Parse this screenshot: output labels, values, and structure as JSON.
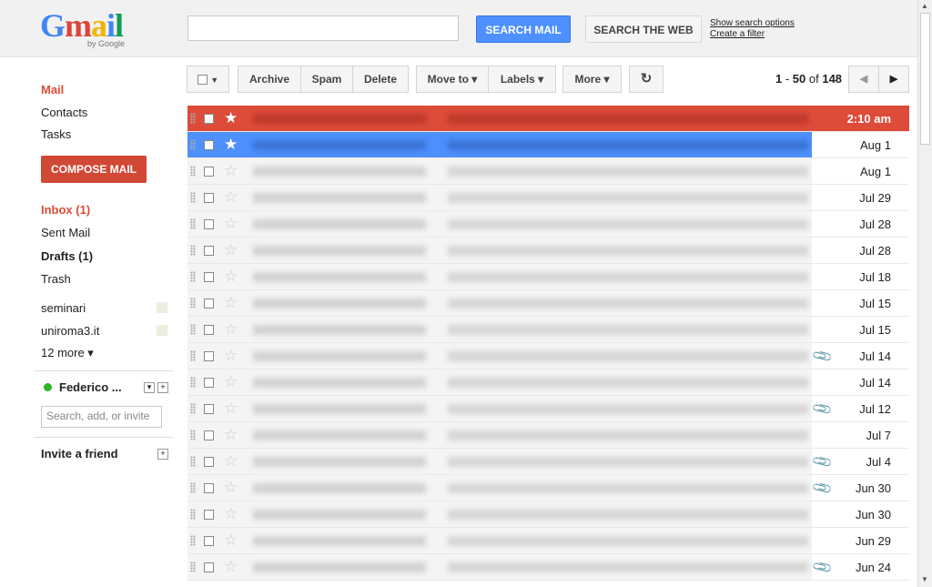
{
  "header": {
    "logo_text": "Gmail",
    "logo_byline": "by Google",
    "search_placeholder": "",
    "search_mail_label": "SEARCH MAIL",
    "search_web_label": "SEARCH THE WEB",
    "show_search_options": "Show search options",
    "create_filter": "Create a filter"
  },
  "sidebar": {
    "mail": "Mail",
    "contacts": "Contacts",
    "tasks": "Tasks",
    "compose": "COMPOSE MAIL",
    "inbox": "Inbox (1)",
    "sent": "Sent Mail",
    "drafts": "Drafts (1)",
    "trash": "Trash",
    "label1": "seminari",
    "label2": "uniroma3.it",
    "more": "12 more ▾",
    "chat_user": "Federico ...",
    "chat_search_placeholder": "Search, add, or invite",
    "invite": "Invite a friend"
  },
  "toolbar": {
    "archive": "Archive",
    "spam": "Spam",
    "delete": "Delete",
    "move_to": "Move to ▾",
    "labels": "Labels ▾",
    "more": "More ▾",
    "refresh_icon": "refresh-icon"
  },
  "pager": {
    "start": "1",
    "sep": " - ",
    "end": "50",
    "of": " of ",
    "total": "148"
  },
  "colors": {
    "red_row": "#dd4b39",
    "blue_row": "#4d90fe",
    "compose": "#d14836",
    "search_button": "#4d90fe"
  },
  "emails": [
    {
      "date": "2:10 am",
      "state": "red",
      "starred": true,
      "attachment": false
    },
    {
      "date": "Aug 1",
      "state": "blue",
      "starred": true,
      "attachment": false
    },
    {
      "date": "Aug 1",
      "state": "",
      "starred": false,
      "attachment": false
    },
    {
      "date": "Jul 29",
      "state": "",
      "starred": false,
      "attachment": false
    },
    {
      "date": "Jul 28",
      "state": "",
      "starred": false,
      "attachment": false
    },
    {
      "date": "Jul 28",
      "state": "",
      "starred": false,
      "attachment": false
    },
    {
      "date": "Jul 18",
      "state": "",
      "starred": false,
      "attachment": false
    },
    {
      "date": "Jul 15",
      "state": "",
      "starred": false,
      "attachment": false
    },
    {
      "date": "Jul 15",
      "state": "",
      "starred": false,
      "attachment": false
    },
    {
      "date": "Jul 14",
      "state": "",
      "starred": false,
      "attachment": true
    },
    {
      "date": "Jul 14",
      "state": "",
      "starred": false,
      "attachment": false
    },
    {
      "date": "Jul 12",
      "state": "",
      "starred": false,
      "attachment": true
    },
    {
      "date": "Jul 7",
      "state": "",
      "starred": false,
      "attachment": false
    },
    {
      "date": "Jul 4",
      "state": "",
      "starred": false,
      "attachment": true
    },
    {
      "date": "Jun 30",
      "state": "",
      "starred": false,
      "attachment": true
    },
    {
      "date": "Jun 30",
      "state": "",
      "starred": false,
      "attachment": false
    },
    {
      "date": "Jun 29",
      "state": "",
      "starred": false,
      "attachment": false
    },
    {
      "date": "Jun 24",
      "state": "",
      "starred": false,
      "attachment": true
    }
  ]
}
